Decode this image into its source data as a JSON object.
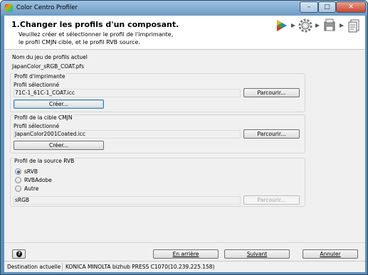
{
  "window": {
    "title": "Color Centro Profiler"
  },
  "header": {
    "title": "1.Changer les profils d'un composant.",
    "description_line1": "Veuillez créer et sélectionner le profil de l'imprimante,",
    "description_line2": "le profil CMJN cible, et le profil RVB source."
  },
  "wizard_steps": [
    {
      "icon": "play-icon"
    },
    {
      "icon": "gear-icon"
    },
    {
      "icon": "printer-icon"
    },
    {
      "icon": "document-icon"
    }
  ],
  "profile_set": {
    "label": "Nom du jeu de profils actuel",
    "value": "JapanColor_sRGB_COAT.pfs"
  },
  "printer_profile": {
    "group_title": "Profil d'imprimante",
    "selected_label": "Profil sélectionné",
    "selected_value": "71C-1_61C-1_COAT.icc",
    "browse_label": "Parcourir...",
    "create_label": "Créer..."
  },
  "cmyk_profile": {
    "group_title": "Profil de la cible CMJN",
    "selected_label": "Profil sélectionné",
    "selected_value": "JapanColor2001Coated.icc",
    "browse_label": "Parcourir...",
    "create_label": "Créer..."
  },
  "rgb_profile": {
    "group_title": "Profil de la source RVB",
    "options": [
      "sRVB",
      "RVBAdobe",
      "Autre"
    ],
    "selected_option": "sRVB",
    "field_value": "sRGB",
    "browse_label": "Parcourir..."
  },
  "footer": {
    "help_label": "?",
    "back_label": "En arrière",
    "next_label": "Suivant",
    "cancel_label": "Annuler"
  },
  "status": {
    "label": "Destination actuelle",
    "value": "KONICA MINOLTA bizhub PRESS C1070(10.239.225.158)"
  },
  "colors": {
    "frame": "#5d8fb8",
    "radio_checked": "#2a62a8"
  }
}
